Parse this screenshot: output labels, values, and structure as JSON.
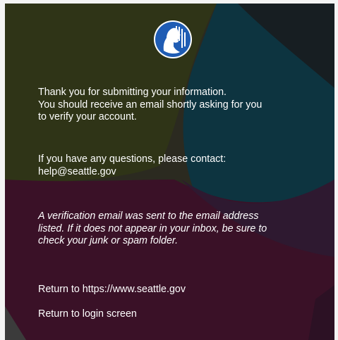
{
  "logo": {
    "icon": "city-seal-icon",
    "color": "#1f5cb4"
  },
  "message": {
    "confirmation": "Thank you for submitting your information.\nYou should receive an email shortly asking for you\nto verify your account.",
    "contact": "If you have any questions, please contact:\nhelp@seattle.gov",
    "verification_note": "A verification email was sent to the email address\nlisted. If it does not appear in your inbox, be sure to\ncheck your junk or spam folder."
  },
  "links": {
    "return_site": "Return to https://www.seattle.gov",
    "return_login": "Return to login screen"
  },
  "colors": {
    "text": "#ffffff",
    "bg_olive": "#2f3417",
    "bg_teal": "#0d3440",
    "bg_maroon": "#3a1127"
  }
}
